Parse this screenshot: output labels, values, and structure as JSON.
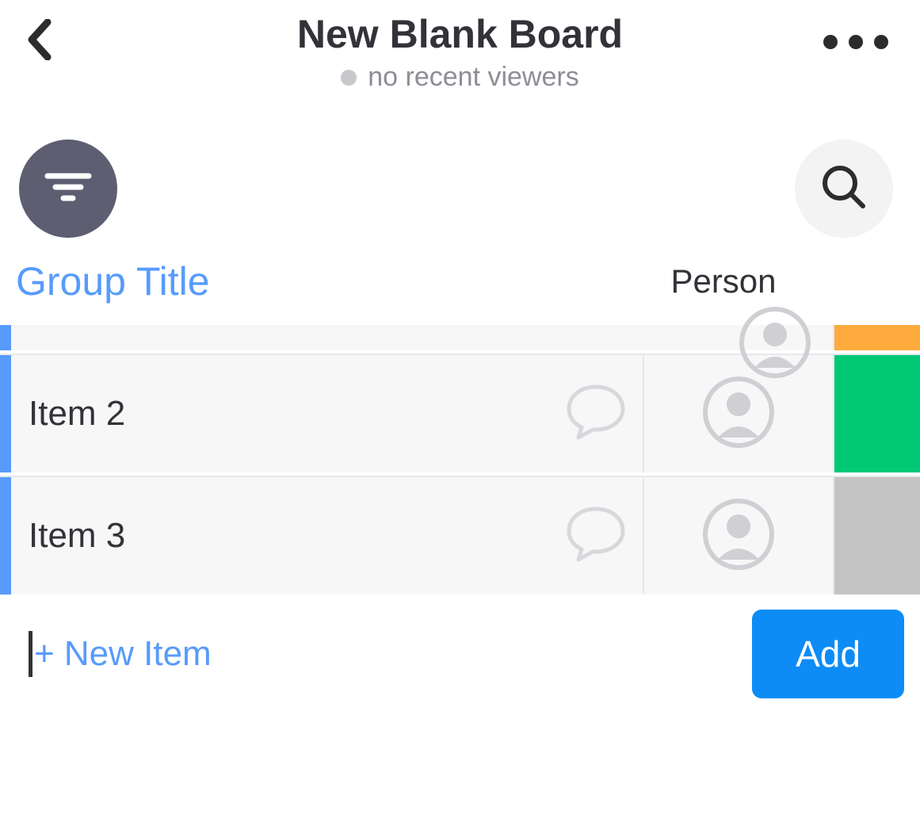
{
  "header": {
    "title": "New Blank Board",
    "subtitle": "no recent viewers"
  },
  "columns": {
    "group_label": "Group Title",
    "person_label": "Person"
  },
  "group": {
    "stripe_color": "#579bfc",
    "rows": [
      {
        "name": "",
        "status_color": "#fdab3d",
        "partial": true
      },
      {
        "name": "Item 2",
        "status_color": "#00c875"
      },
      {
        "name": "Item 3",
        "status_color": "#c4c4c4"
      }
    ]
  },
  "new_item": {
    "placeholder": "+ New Item",
    "add_label": "Add"
  },
  "icons": {
    "back": "chevron-left",
    "more": "ellipsis",
    "filter": "filter",
    "search": "magnify",
    "chat": "speech-bubble",
    "person": "avatar-placeholder"
  },
  "colors": {
    "accent_blue": "#579bfc",
    "button_blue": "#0d8cf6",
    "filter_bg": "#5e5e72",
    "search_bg": "#f3f3f4",
    "row_bg": "#f7f7f8"
  }
}
